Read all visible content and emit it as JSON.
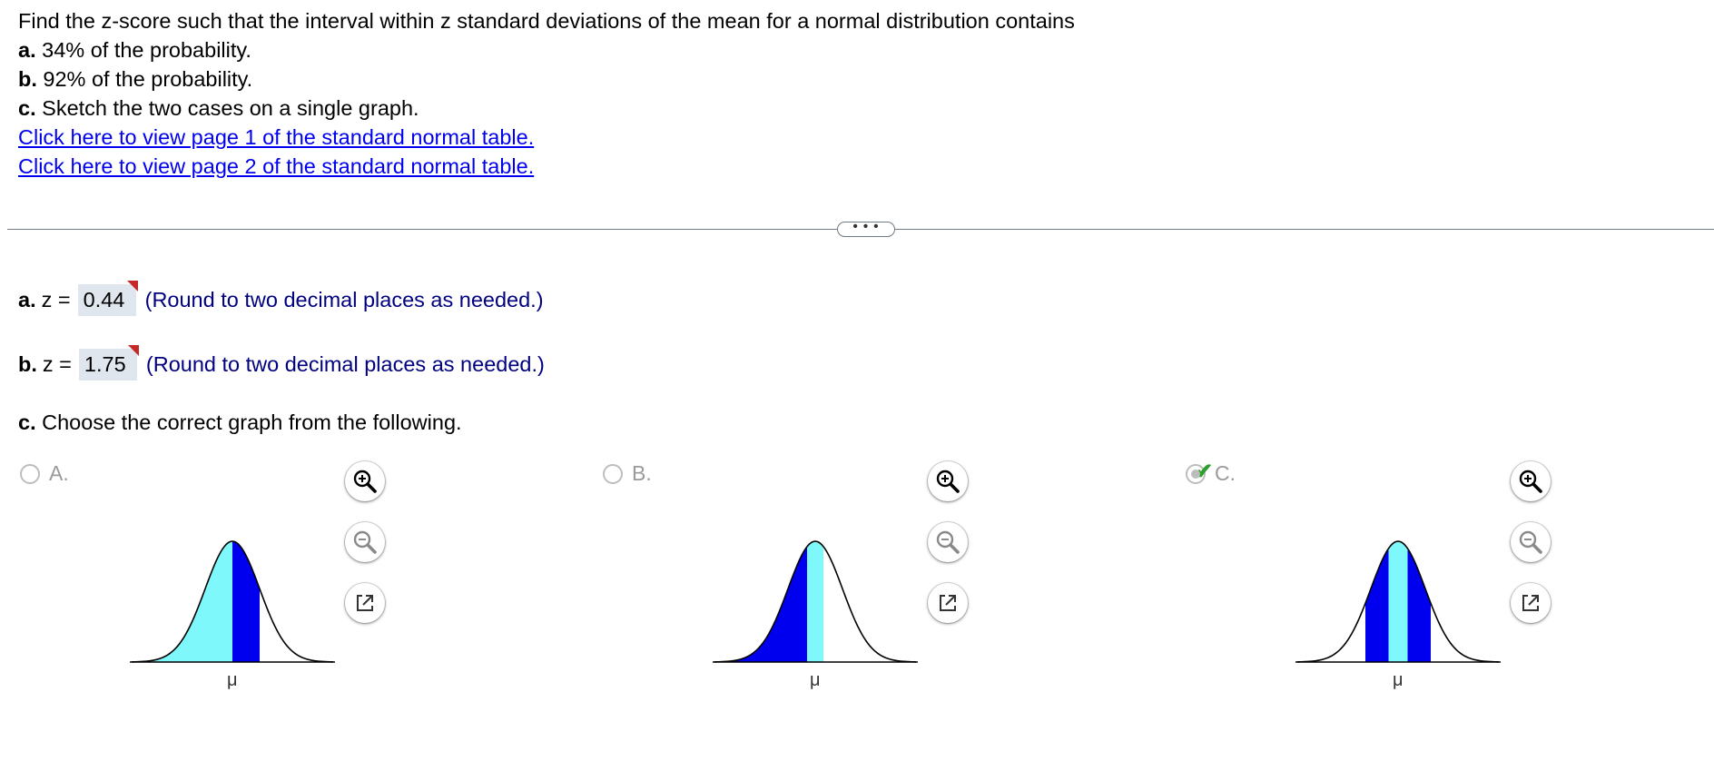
{
  "question": {
    "line1": "Find the z-score such that the interval within z standard deviations of the mean for a normal distribution contains",
    "a_label": "a.",
    "a_text": " 34% of the probability.",
    "b_label": "b.",
    "b_text": " 92% of the probability.",
    "c_label": "c.",
    "c_text": " Sketch the two cases on a single graph.",
    "link1": "Click here to view page 1 of the standard normal table.",
    "link2": "Click here to view page 2 of the standard normal table."
  },
  "divider_button": "• • •",
  "answers": {
    "a": {
      "label": "a.",
      "z": "z =",
      "value": "0.44",
      "hint": "(Round to two decimal places as needed.)"
    },
    "b": {
      "label": "b.",
      "z": "z =",
      "value": "1.75",
      "hint": "(Round to two decimal places as needed.)"
    }
  },
  "choose": {
    "label": "c.",
    "text": " Choose the correct graph from the following."
  },
  "options": [
    {
      "letter": "A.",
      "selected": false,
      "correct": false,
      "mu": "μ"
    },
    {
      "letter": "B.",
      "selected": false,
      "correct": false,
      "mu": "μ"
    },
    {
      "letter": "C.",
      "selected": true,
      "correct": true,
      "mu": "μ"
    }
  ],
  "check_mark": "✔",
  "colors": {
    "light": "#7ff8fc",
    "dark": "#0000ee",
    "link": "#0000ee",
    "hint": "#000080"
  }
}
